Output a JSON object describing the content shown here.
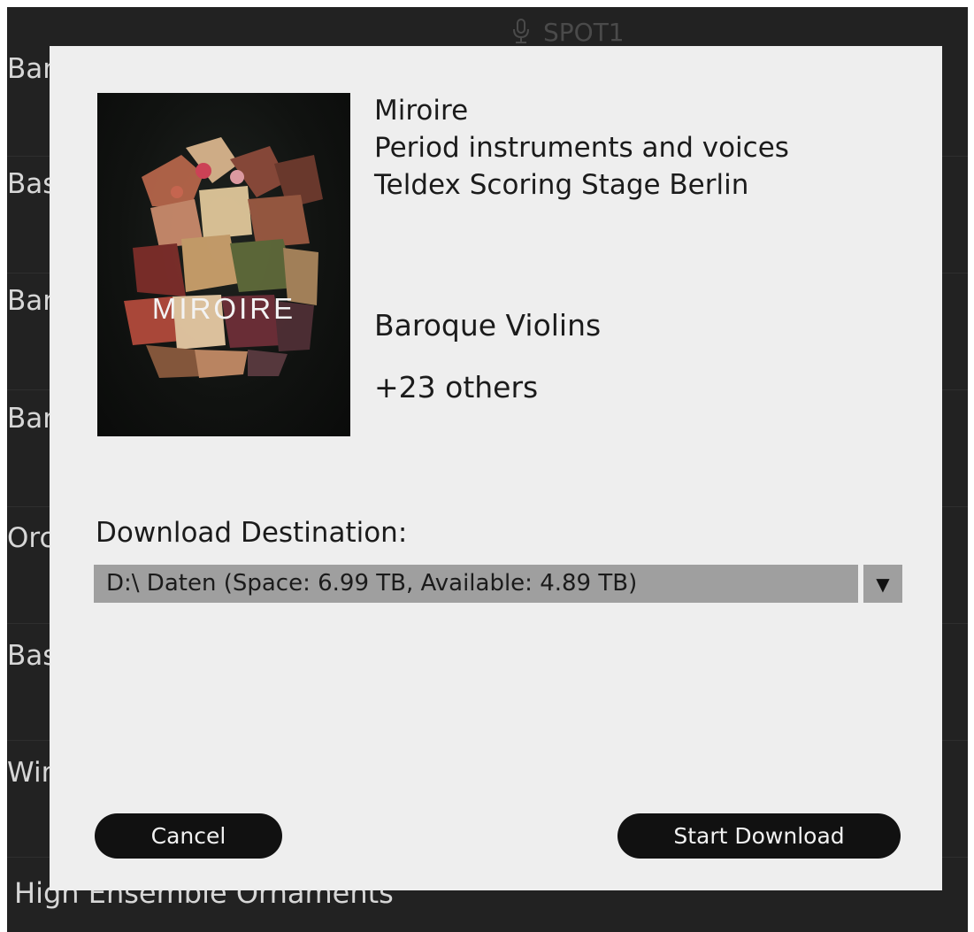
{
  "header": {
    "title": "SPOT1",
    "icon": "microphone-icon"
  },
  "background_list": {
    "rows": [
      "Barc",
      "Bass",
      "Barc",
      "Barc",
      "Orcl",
      "Bass",
      "Win"
    ],
    "bottom_item": "High Ensemble Ornaments"
  },
  "dialog": {
    "cover": {
      "title": "MIROIRE"
    },
    "library_name": "Miroire",
    "subtitle": "Period instruments and voices",
    "venue": "Teldex Scoring Stage Berlin",
    "instrument": "Baroque Violins",
    "others": "+23 others",
    "destination_label": "Download Destination:",
    "destination_value": "D:\\ Daten (Space: 6.99 TB, Available: 4.89 TB)",
    "dropdown_arrow": "▼",
    "cancel_label": "Cancel",
    "start_label": "Start Download"
  },
  "colors": {
    "app_background": "#222222",
    "dialog_background": "#eeeeee",
    "select_background": "#9f9f9f",
    "button_background": "#111111"
  }
}
